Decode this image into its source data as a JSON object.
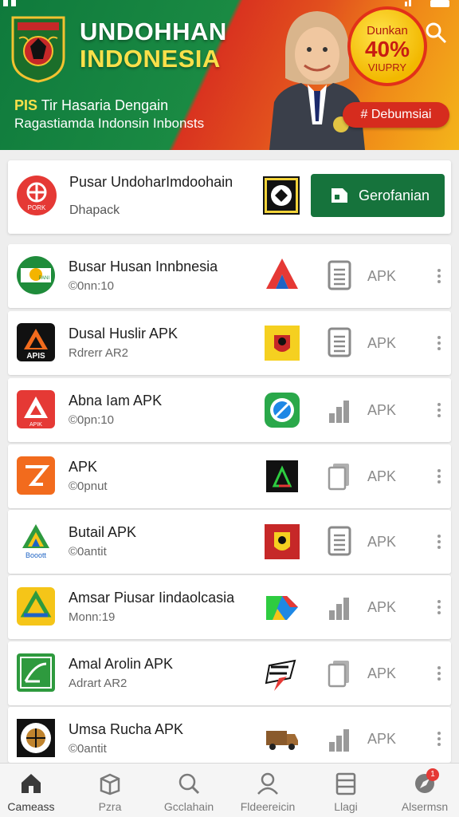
{
  "banner": {
    "title_line1": "UNDOHHAN",
    "title_line2": "INDONESIA",
    "subtitle_prefix": "PIS",
    "subtitle_line1": "Tir Hasaria Dengain",
    "subtitle_line2": "Ragastiamda  Indonsin Inbonsts",
    "badge_top": "Dunkan",
    "badge_value": "40%",
    "badge_bottom": "VIUPRY",
    "cta_label": "# Debumsiai"
  },
  "featured": {
    "name": "Pusar UndoharImdoohain",
    "sub": "Dhapack",
    "logo_text": "PORK",
    "button_label": "Gerofanian"
  },
  "apps": [
    {
      "name": "Busar Husan Innbnesia",
      "sub": "©0nn:10",
      "tag": "APK",
      "logo_text": "PANI",
      "logo_bg": "#ffffff",
      "thumb": "tri-blue",
      "ticon": "doc"
    },
    {
      "name": "Dusal Huslir APK",
      "sub": "Rdrerr AR2",
      "tag": "APK",
      "logo_text": "APIS",
      "logo_bg": "#111111",
      "thumb": "emblem-yellow",
      "ticon": "doc"
    },
    {
      "name": "Abna Iam APK",
      "sub": "©0pn:10",
      "tag": "APK",
      "logo_text": "APIK",
      "logo_bg": "#e53935",
      "thumb": "green-circle",
      "ticon": "bars"
    },
    {
      "name": "APK",
      "sub": "©0pnut",
      "tag": "APK",
      "logo_text": "",
      "logo_bg": "#f26b1d",
      "thumb": "black-tri",
      "ticon": "copy"
    },
    {
      "name": "Butail APK",
      "sub": "©0antit",
      "tag": "APK",
      "logo_text": "Booott",
      "logo_bg": "#ffffff",
      "thumb": "emblem-red",
      "ticon": "doc"
    },
    {
      "name": "Amsar Piusar Iindaolcasia",
      "sub": "Monn:19",
      "tag": "APK",
      "logo_text": "",
      "logo_bg": "#f5c518",
      "thumb": "colorful",
      "ticon": "bars"
    },
    {
      "name": "Amal Arolin APK",
      "sub": "Adrart AR2",
      "tag": "APK",
      "logo_text": "",
      "logo_bg": "#2e9a3e",
      "thumb": "zpr",
      "ticon": "copy"
    },
    {
      "name": "Umsa Rucha APK",
      "sub": "©0antit",
      "tag": "APK",
      "logo_text": "",
      "logo_bg": "#ffffff",
      "thumb": "truck",
      "ticon": "bars"
    }
  ],
  "nav": [
    {
      "label": "Cameass",
      "icon": "home-icon",
      "active": true
    },
    {
      "label": "Pzra",
      "icon": "box-icon",
      "active": false
    },
    {
      "label": "Gcclahain",
      "icon": "search-icon",
      "active": false
    },
    {
      "label": "Fldeereicin",
      "icon": "person-icon",
      "active": false
    },
    {
      "label": "Llagi",
      "icon": "list-icon",
      "active": false
    },
    {
      "label": "Alsermsn",
      "icon": "compass-icon",
      "active": false,
      "badge": "1"
    }
  ],
  "colors": {
    "brand_green": "#16733c",
    "accent_red": "#d62c1e",
    "accent_yellow": "#f9e04a"
  }
}
